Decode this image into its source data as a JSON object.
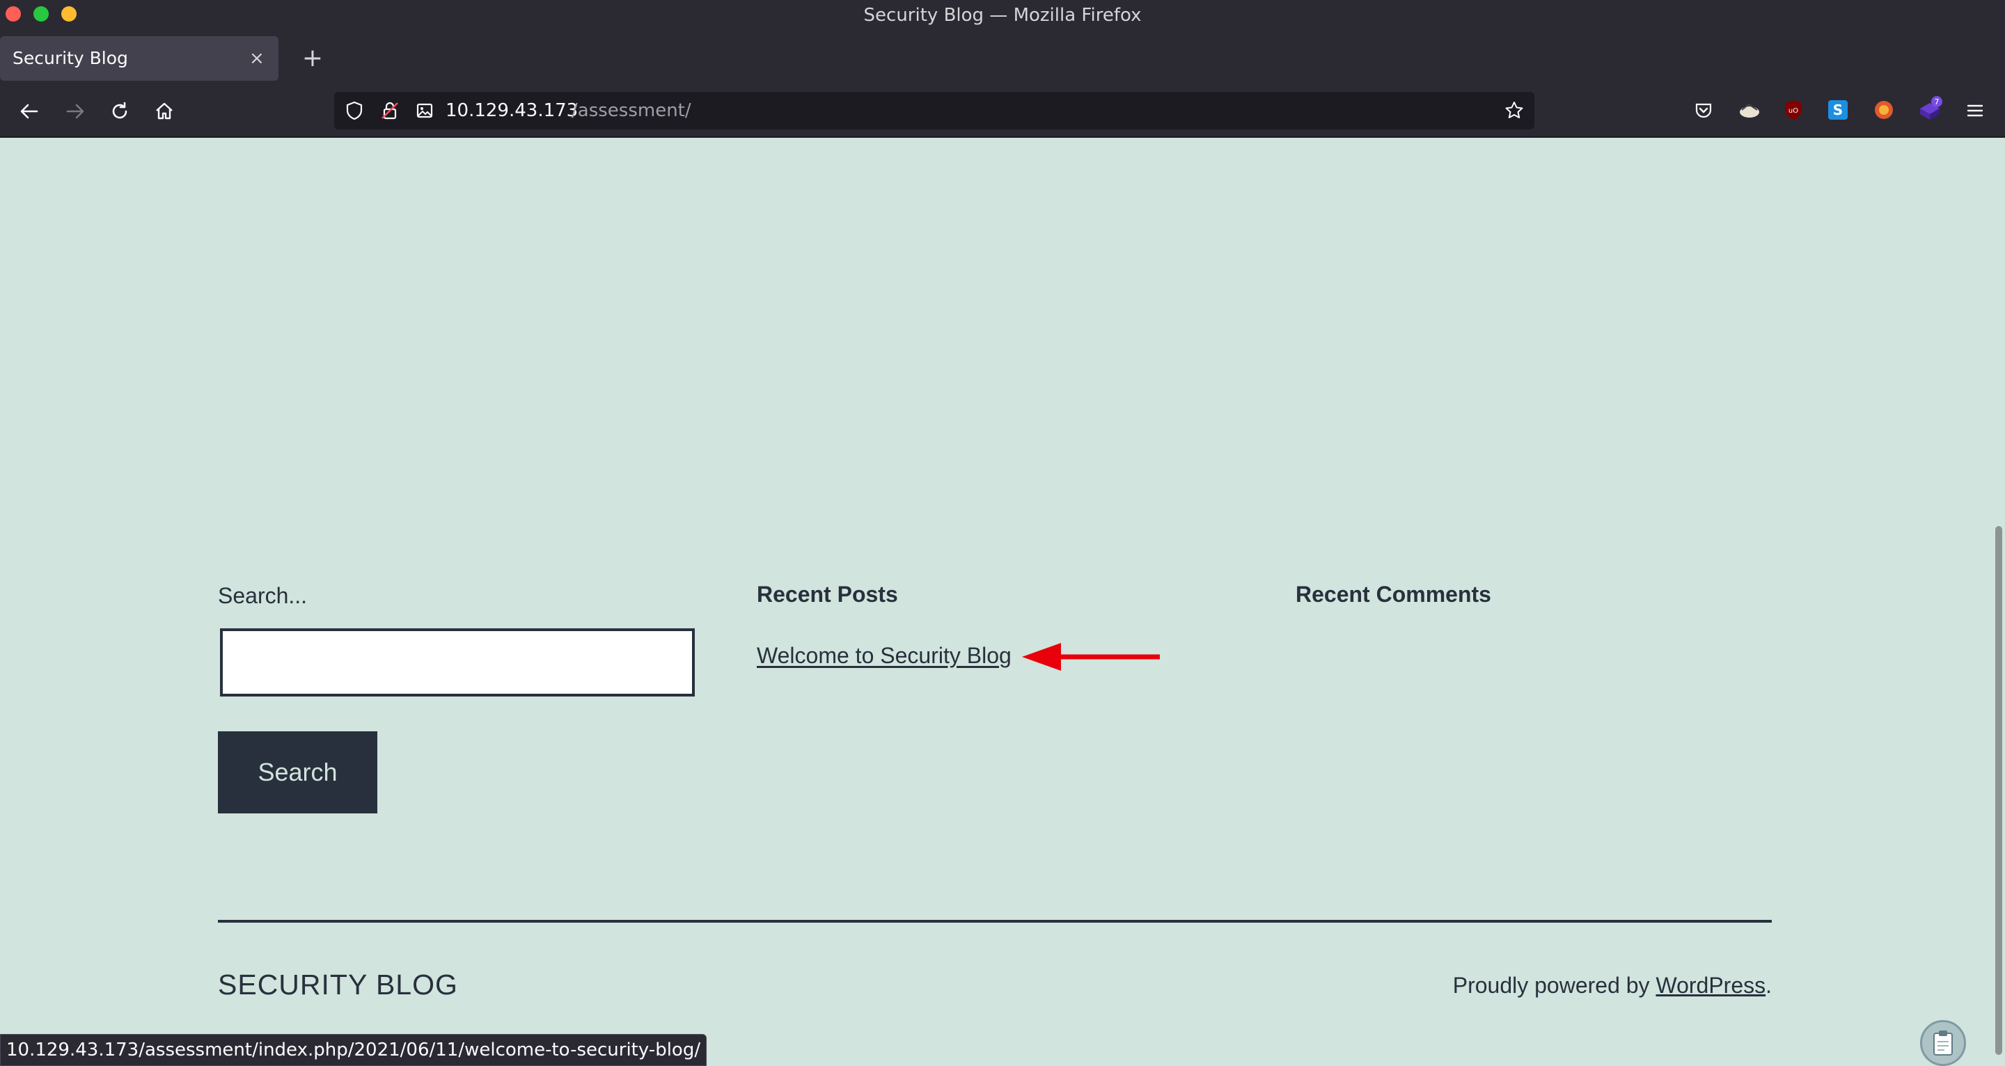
{
  "window": {
    "title": "Security Blog — Mozilla Firefox"
  },
  "tabs": [
    {
      "label": "Security Blog",
      "close": "×"
    }
  ],
  "newtab": "+",
  "url": {
    "host": "10.129.43.173",
    "path": "/assessment/"
  },
  "widgets": {
    "search_label": "Search...",
    "search_button": "Search",
    "search_value": "",
    "recent_posts_heading": "Recent Posts",
    "recent_posts": [
      "Welcome to Security Blog"
    ],
    "recent_comments_heading": "Recent Comments"
  },
  "footer": {
    "site_title": "SECURITY BLOG",
    "powered_prefix": "Proudly powered by ",
    "powered_link": "WordPress",
    "powered_suffix": "."
  },
  "status_url": "10.129.43.173/assessment/index.php/2021/06/11/welcome-to-security-blog/",
  "extensions_badge": "7",
  "colors": {
    "page_bg": "#d1e4dd",
    "text": "#28303d",
    "chrome": "#2b2a33",
    "annotation_arrow": "#e8000b"
  },
  "icons": [
    "back-icon",
    "forward-icon",
    "reload-icon",
    "home-icon",
    "shield-icon",
    "lock-icon",
    "image-icon",
    "bookmark-star-icon",
    "pocket-icon",
    "extension-icon",
    "ublock-icon",
    "s-extension-icon",
    "foxyproxy-icon",
    "extension-badge-icon",
    "menu-icon",
    "clipboard-icon"
  ]
}
